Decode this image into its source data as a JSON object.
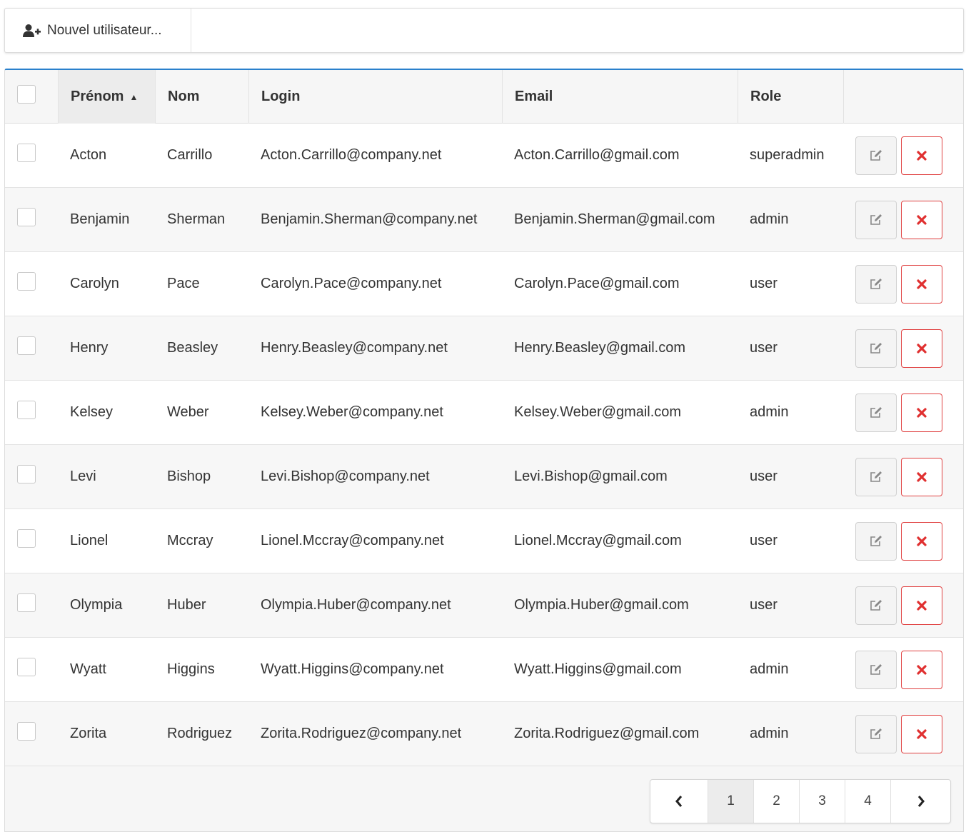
{
  "toolbar": {
    "new_user_label": "Nouvel utilisateur..."
  },
  "columns": [
    {
      "key": "first_name",
      "label": "Prénom",
      "sorted": "asc"
    },
    {
      "key": "last_name",
      "label": "Nom"
    },
    {
      "key": "login",
      "label": "Login"
    },
    {
      "key": "email",
      "label": "Email"
    },
    {
      "key": "role",
      "label": "Role"
    }
  ],
  "rows": [
    {
      "first_name": "Acton",
      "last_name": "Carrillo",
      "login": "Acton.Carrillo@company.net",
      "email": "Acton.Carrillo@gmail.com",
      "role": "superadmin"
    },
    {
      "first_name": "Benjamin",
      "last_name": "Sherman",
      "login": "Benjamin.Sherman@company.net",
      "email": "Benjamin.Sherman@gmail.com",
      "role": "admin"
    },
    {
      "first_name": "Carolyn",
      "last_name": "Pace",
      "login": "Carolyn.Pace@company.net",
      "email": "Carolyn.Pace@gmail.com",
      "role": "user"
    },
    {
      "first_name": "Henry",
      "last_name": "Beasley",
      "login": "Henry.Beasley@company.net",
      "email": "Henry.Beasley@gmail.com",
      "role": "user"
    },
    {
      "first_name": "Kelsey",
      "last_name": "Weber",
      "login": "Kelsey.Weber@company.net",
      "email": "Kelsey.Weber@gmail.com",
      "role": "admin"
    },
    {
      "first_name": "Levi",
      "last_name": "Bishop",
      "login": "Levi.Bishop@company.net",
      "email": "Levi.Bishop@gmail.com",
      "role": "user"
    },
    {
      "first_name": "Lionel",
      "last_name": "Mccray",
      "login": "Lionel.Mccray@company.net",
      "email": "Lionel.Mccray@gmail.com",
      "role": "user"
    },
    {
      "first_name": "Olympia",
      "last_name": "Huber",
      "login": "Olympia.Huber@company.net",
      "email": "Olympia.Huber@gmail.com",
      "role": "user"
    },
    {
      "first_name": "Wyatt",
      "last_name": "Higgins",
      "login": "Wyatt.Higgins@company.net",
      "email": "Wyatt.Higgins@gmail.com",
      "role": "admin"
    },
    {
      "first_name": "Zorita",
      "last_name": "Rodriguez",
      "login": "Zorita.Rodriguez@company.net",
      "email": "Zorita.Rodriguez@gmail.com",
      "role": "admin"
    }
  ],
  "row_actions": {
    "edit_icon": "edit-icon",
    "delete_icon": "delete-icon",
    "delete_color": "#e03030"
  },
  "pagination": {
    "prev_icon": "chevron-left-icon",
    "next_icon": "chevron-right-icon",
    "pages": [
      "1",
      "2",
      "3",
      "4"
    ],
    "current": "1"
  },
  "colors": {
    "accent": "#2a80cc"
  }
}
